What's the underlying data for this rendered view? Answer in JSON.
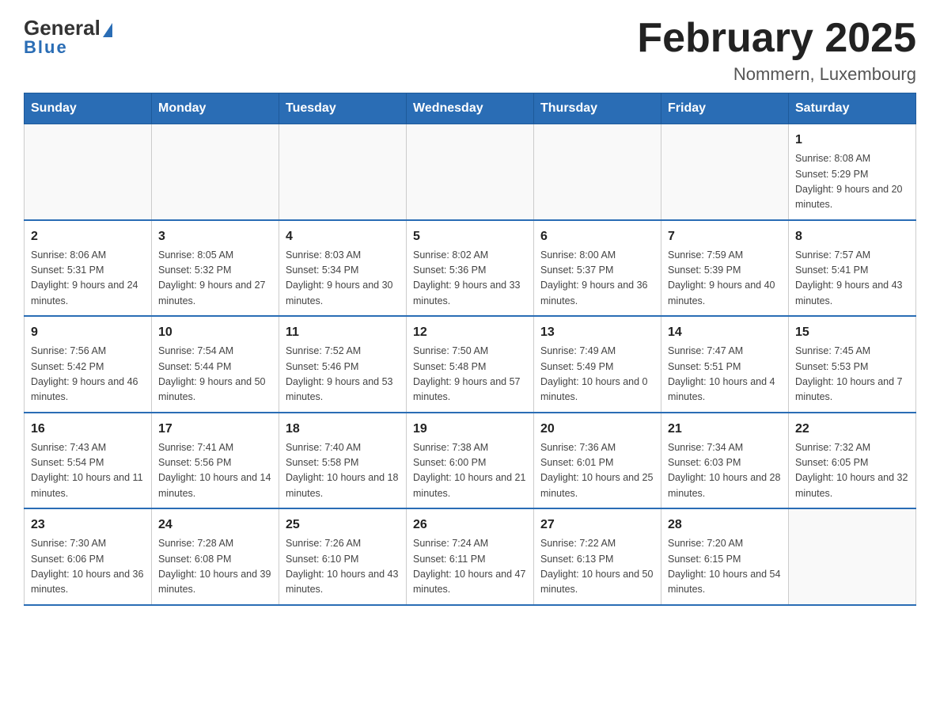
{
  "logo": {
    "text_general": "General",
    "text_blue": "Blue"
  },
  "header": {
    "title": "February 2025",
    "subtitle": "Nommern, Luxembourg"
  },
  "days_of_week": [
    "Sunday",
    "Monday",
    "Tuesday",
    "Wednesday",
    "Thursday",
    "Friday",
    "Saturday"
  ],
  "weeks": [
    [
      {
        "day": "",
        "info": ""
      },
      {
        "day": "",
        "info": ""
      },
      {
        "day": "",
        "info": ""
      },
      {
        "day": "",
        "info": ""
      },
      {
        "day": "",
        "info": ""
      },
      {
        "day": "",
        "info": ""
      },
      {
        "day": "1",
        "info": "Sunrise: 8:08 AM\nSunset: 5:29 PM\nDaylight: 9 hours and 20 minutes."
      }
    ],
    [
      {
        "day": "2",
        "info": "Sunrise: 8:06 AM\nSunset: 5:31 PM\nDaylight: 9 hours and 24 minutes."
      },
      {
        "day": "3",
        "info": "Sunrise: 8:05 AM\nSunset: 5:32 PM\nDaylight: 9 hours and 27 minutes."
      },
      {
        "day": "4",
        "info": "Sunrise: 8:03 AM\nSunset: 5:34 PM\nDaylight: 9 hours and 30 minutes."
      },
      {
        "day": "5",
        "info": "Sunrise: 8:02 AM\nSunset: 5:36 PM\nDaylight: 9 hours and 33 minutes."
      },
      {
        "day": "6",
        "info": "Sunrise: 8:00 AM\nSunset: 5:37 PM\nDaylight: 9 hours and 36 minutes."
      },
      {
        "day": "7",
        "info": "Sunrise: 7:59 AM\nSunset: 5:39 PM\nDaylight: 9 hours and 40 minutes."
      },
      {
        "day": "8",
        "info": "Sunrise: 7:57 AM\nSunset: 5:41 PM\nDaylight: 9 hours and 43 minutes."
      }
    ],
    [
      {
        "day": "9",
        "info": "Sunrise: 7:56 AM\nSunset: 5:42 PM\nDaylight: 9 hours and 46 minutes."
      },
      {
        "day": "10",
        "info": "Sunrise: 7:54 AM\nSunset: 5:44 PM\nDaylight: 9 hours and 50 minutes."
      },
      {
        "day": "11",
        "info": "Sunrise: 7:52 AM\nSunset: 5:46 PM\nDaylight: 9 hours and 53 minutes."
      },
      {
        "day": "12",
        "info": "Sunrise: 7:50 AM\nSunset: 5:48 PM\nDaylight: 9 hours and 57 minutes."
      },
      {
        "day": "13",
        "info": "Sunrise: 7:49 AM\nSunset: 5:49 PM\nDaylight: 10 hours and 0 minutes."
      },
      {
        "day": "14",
        "info": "Sunrise: 7:47 AM\nSunset: 5:51 PM\nDaylight: 10 hours and 4 minutes."
      },
      {
        "day": "15",
        "info": "Sunrise: 7:45 AM\nSunset: 5:53 PM\nDaylight: 10 hours and 7 minutes."
      }
    ],
    [
      {
        "day": "16",
        "info": "Sunrise: 7:43 AM\nSunset: 5:54 PM\nDaylight: 10 hours and 11 minutes."
      },
      {
        "day": "17",
        "info": "Sunrise: 7:41 AM\nSunset: 5:56 PM\nDaylight: 10 hours and 14 minutes."
      },
      {
        "day": "18",
        "info": "Sunrise: 7:40 AM\nSunset: 5:58 PM\nDaylight: 10 hours and 18 minutes."
      },
      {
        "day": "19",
        "info": "Sunrise: 7:38 AM\nSunset: 6:00 PM\nDaylight: 10 hours and 21 minutes."
      },
      {
        "day": "20",
        "info": "Sunrise: 7:36 AM\nSunset: 6:01 PM\nDaylight: 10 hours and 25 minutes."
      },
      {
        "day": "21",
        "info": "Sunrise: 7:34 AM\nSunset: 6:03 PM\nDaylight: 10 hours and 28 minutes."
      },
      {
        "day": "22",
        "info": "Sunrise: 7:32 AM\nSunset: 6:05 PM\nDaylight: 10 hours and 32 minutes."
      }
    ],
    [
      {
        "day": "23",
        "info": "Sunrise: 7:30 AM\nSunset: 6:06 PM\nDaylight: 10 hours and 36 minutes."
      },
      {
        "day": "24",
        "info": "Sunrise: 7:28 AM\nSunset: 6:08 PM\nDaylight: 10 hours and 39 minutes."
      },
      {
        "day": "25",
        "info": "Sunrise: 7:26 AM\nSunset: 6:10 PM\nDaylight: 10 hours and 43 minutes."
      },
      {
        "day": "26",
        "info": "Sunrise: 7:24 AM\nSunset: 6:11 PM\nDaylight: 10 hours and 47 minutes."
      },
      {
        "day": "27",
        "info": "Sunrise: 7:22 AM\nSunset: 6:13 PM\nDaylight: 10 hours and 50 minutes."
      },
      {
        "day": "28",
        "info": "Sunrise: 7:20 AM\nSunset: 6:15 PM\nDaylight: 10 hours and 54 minutes."
      },
      {
        "day": "",
        "info": ""
      }
    ]
  ]
}
